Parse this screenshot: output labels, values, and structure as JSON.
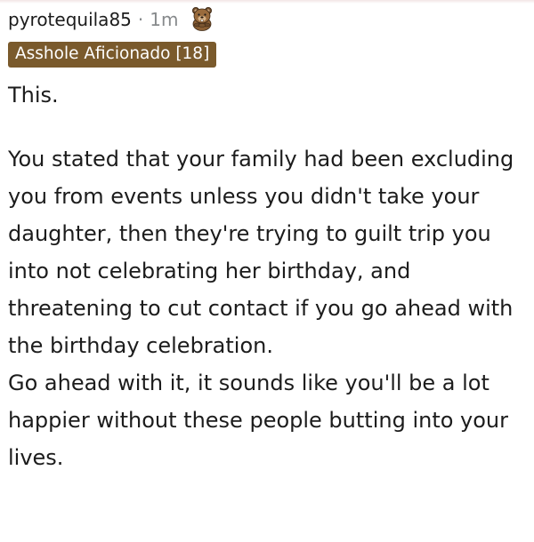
{
  "comment": {
    "username": "pyrotequila85",
    "separator": "·",
    "timestamp": "1m",
    "award_icon": "beaver-award-icon",
    "flair": "Asshole Aficionado [18]",
    "body": {
      "paragraph1": "This.",
      "paragraph2": "You stated that your family had been excluding you from events unless you didn't take your daughter, then they're trying to guilt trip you into not celebrating her birthday, and threatening to cut contact if you go ahead with the birthday celebration.",
      "paragraph3": "Go ahead with it, it sounds like you'll be a lot happier without these people butting into your lives."
    }
  },
  "colors": {
    "flair_background": "#7a5a2c",
    "flair_text": "#ffffff",
    "meta_gray": "#878a8c",
    "text": "#1c1c1c"
  }
}
